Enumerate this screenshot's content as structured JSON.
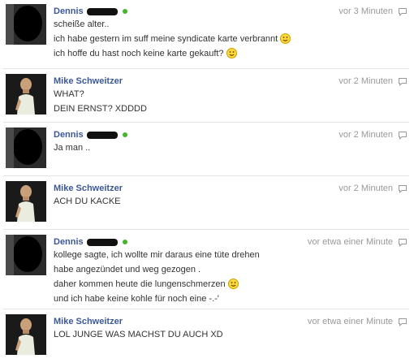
{
  "colors": {
    "name": "#3b5998",
    "online": "#42b72a",
    "time": "#999999",
    "text": "#333333"
  },
  "messages": [
    {
      "author": "Dennis",
      "online": true,
      "censored": true,
      "avatar": "dark-avatar",
      "time": "vor 3 Minuten",
      "lines": [
        {
          "text": "scheiße alter..",
          "emoji": false
        },
        {
          "text": "ich habe gestern im suff meine syndicate karte verbrannt",
          "emoji": true
        },
        {
          "text": "ich hoffe du hast noch keine karte gekauft?",
          "emoji": true
        }
      ]
    },
    {
      "author": "Mike Schweitzer",
      "online": false,
      "censored": false,
      "avatar": "photo-avatar",
      "time": "vor 2 Minuten",
      "lines": [
        {
          "text": "WHAT?",
          "emoji": false
        },
        {
          "text": "DEIN ERNST? XDDDD",
          "emoji": false
        }
      ]
    },
    {
      "author": "Dennis",
      "online": true,
      "censored": true,
      "avatar": "dark-avatar",
      "time": "vor 2 Minuten",
      "lines": [
        {
          "text": "Ja man ..",
          "emoji": false
        }
      ]
    },
    {
      "author": "Mike Schweitzer",
      "online": false,
      "censored": false,
      "avatar": "photo-avatar",
      "time": "vor 2 Minuten",
      "lines": [
        {
          "text": "ACH DU KACKE",
          "emoji": false
        }
      ]
    },
    {
      "author": "Dennis",
      "online": true,
      "censored": true,
      "avatar": "dark-avatar",
      "time": "vor etwa einer Minute",
      "lines": [
        {
          "text": "kollege sagte, ich wollte mir daraus eine tüte drehen",
          "emoji": false
        },
        {
          "text": "habe angezündet und weg gezogen .",
          "emoji": false
        },
        {
          "text": "daher kommen heute die lungenschmerzen",
          "emoji": true
        },
        {
          "text": "und ich habe keine kohle für noch eine -.-'",
          "emoji": false
        }
      ]
    },
    {
      "author": "Mike Schweitzer",
      "online": false,
      "censored": false,
      "avatar": "photo-avatar",
      "time": "vor etwa einer Minute",
      "lines": [
        {
          "text": "LOL JUNGE WAS MACHST DU AUCH XD",
          "emoji": false
        }
      ]
    }
  ]
}
